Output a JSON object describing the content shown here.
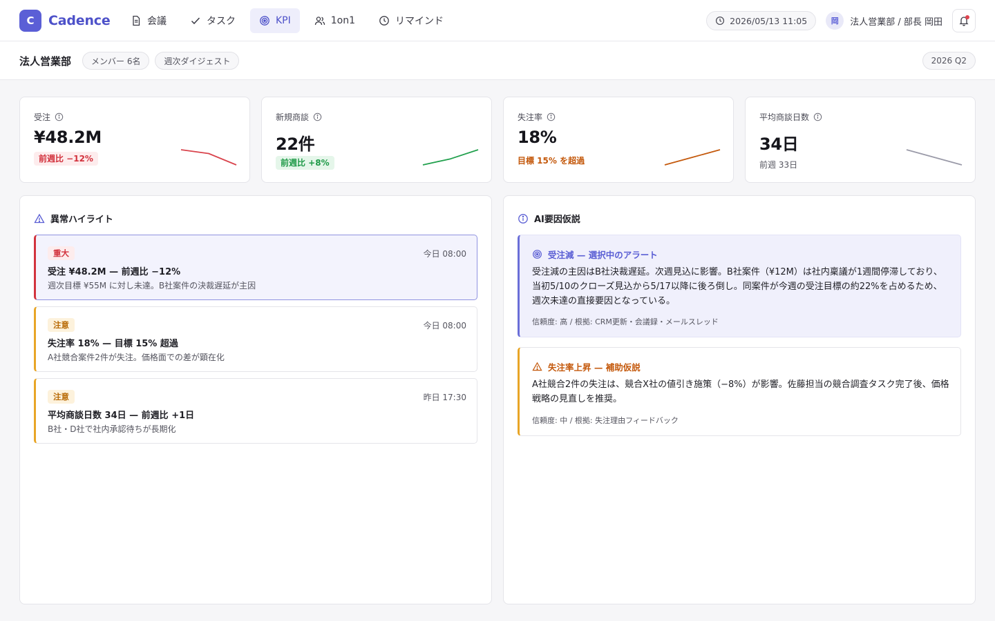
{
  "app": {
    "logo_letter": "C",
    "name": "Cadence"
  },
  "nav": {
    "items": [
      {
        "label": "会議",
        "icon": "document-icon"
      },
      {
        "label": "タスク",
        "icon": "check-icon"
      },
      {
        "label": "KPI",
        "icon": "target-icon",
        "active": true
      },
      {
        "label": "1on1",
        "icon": "people-icon"
      },
      {
        "label": "リマインド",
        "icon": "clock-icon"
      }
    ]
  },
  "header": {
    "datetime": "2026/05/13 11:05",
    "user_avatar": "岡",
    "user_label": "法人営業部 / 部長 岡田"
  },
  "subheader": {
    "department": "法人営業部",
    "members": "メンバー 6名",
    "digest": "週次ダイジェスト",
    "quarter": "2026 Q2"
  },
  "kpis": [
    {
      "label": "受注",
      "value": "¥48.2M",
      "sub": "前週比 −12%",
      "trend": [
        5,
        4,
        1
      ],
      "color": "#d9434c"
    },
    {
      "label": "新規商談",
      "value": "22件",
      "sub": "前週比 +8%",
      "trend": [
        1,
        3,
        6
      ],
      "color": "#21a04d"
    },
    {
      "label": "失注率",
      "value": "18%",
      "sub": "目標 15% を超過",
      "trend": [
        1,
        3,
        5
      ],
      "color": "#c4590c"
    },
    {
      "label": "平均商談日数",
      "value": "34日",
      "sub": "前週 33日",
      "trend": [
        4,
        3.5,
        3
      ],
      "color": "#9a9aa8"
    }
  ],
  "anomalies": {
    "title": "異常ハイライト",
    "items": [
      {
        "tag": "重大",
        "time": "今日 08:00",
        "title": "受注 ¥48.2M — 前週比 −12%",
        "desc": "週次目標 ¥55M に対し未達。B社案件の決裁遅延が主因"
      },
      {
        "tag": "注意",
        "time": "今日 08:00",
        "title": "失注率 18% — 目標 15% 超過",
        "desc": "A社競合案件2件が失注。価格面での差が顕在化"
      },
      {
        "tag": "注意",
        "time": "昨日 17:30",
        "title": "平均商談日数 34日 — 前週比 +1日",
        "desc": "B社・D社で社内承認待ちが長期化"
      }
    ]
  },
  "hypotheses": {
    "title": "AI要因仮説",
    "primary": {
      "head": "受注減 — 選択中のアラート",
      "body": "受注減の主因はB社決裁遅延。次週見込に影響。B社案件（¥12M）は社内稟議が1週間停滞しており、当初5/10のクローズ見込から5/17以降に後ろ倒し。同案件が今週の受注目標の約22%を占めるため、週次未達の直接要因となっている。",
      "meta": "信頼度: 高 / 根拠: CRM更新・会議録・メールスレッド"
    },
    "secondary": {
      "head": "失注率上昇 — 補助仮説",
      "body": "A社競合2件の失注は、競合X社の値引き施策（−8%）が影響。佐藤担当の競合調査タスク完了後、価格戦略の見直しを推奨。",
      "meta": "信頼度: 中 / 根拠: 失注理由フィードバック"
    }
  }
}
